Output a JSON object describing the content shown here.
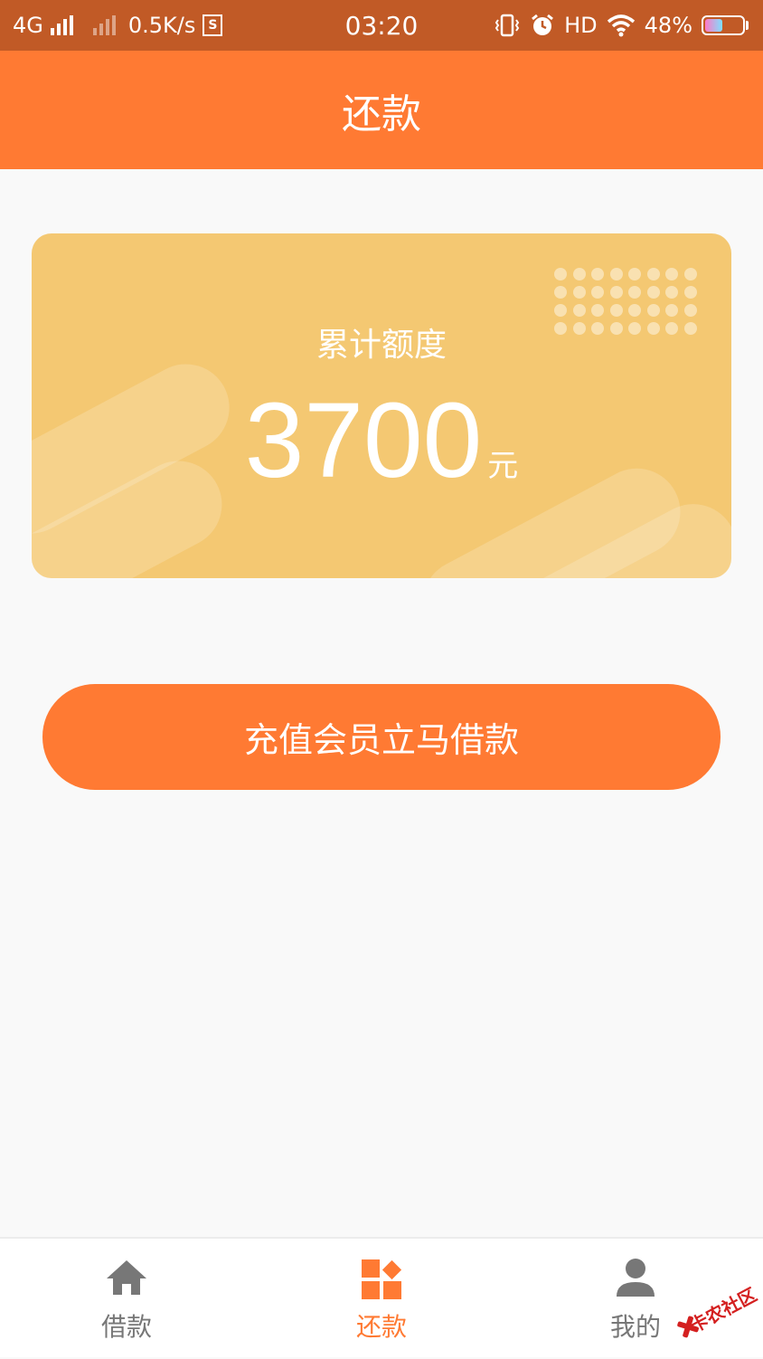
{
  "status_bar": {
    "network": "4G",
    "speed": "0.5K/s",
    "sim_icon_letter": "S",
    "time": "03:20",
    "hd": "HD",
    "battery_text": "48%",
    "battery_level": 0.48
  },
  "header": {
    "title": "还款"
  },
  "card": {
    "label": "累计额度",
    "amount": "3700",
    "unit": "元",
    "color": "#f4c872"
  },
  "cta": {
    "label": "充值会员立马借款"
  },
  "tabs": [
    {
      "label": "借款",
      "icon": "home-icon",
      "active": false
    },
    {
      "label": "还款",
      "icon": "blocks-icon",
      "active": true
    },
    {
      "label": "我的",
      "icon": "person-icon",
      "active": false
    }
  ],
  "watermark": {
    "text": "卡农社区"
  },
  "colors": {
    "accent": "#ff7a33",
    "status_bar": "#c15a26",
    "inactive": "#777777"
  }
}
